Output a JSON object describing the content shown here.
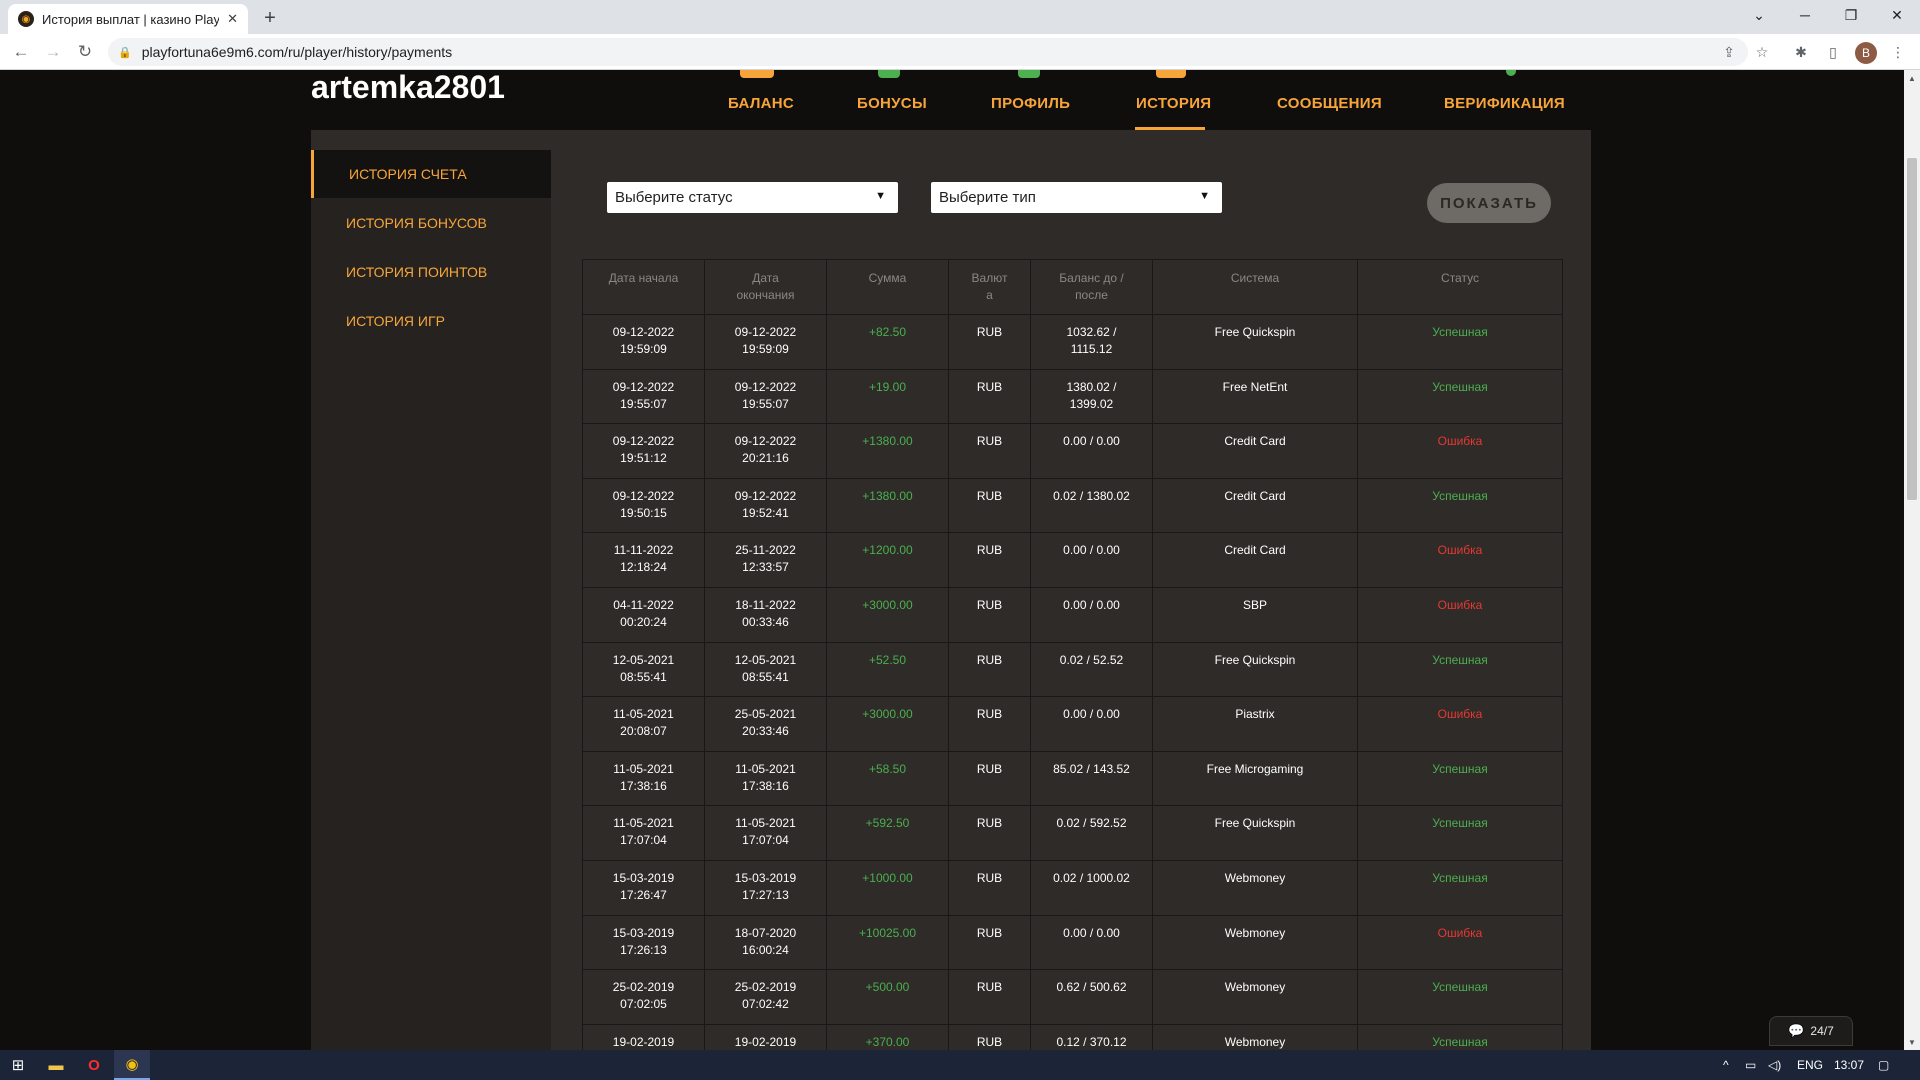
{
  "browser": {
    "tab_title": "История выплат | казино Playfo",
    "favicon_glyph": "◉",
    "close_glyph": "✕",
    "newtab_glyph": "+",
    "url": "playfortuna6e9m6.com/ru/player/history/payments",
    "profile_initial": "B",
    "controls": {
      "chevron": "⌄",
      "minimize": "─",
      "restore": "❐",
      "close": "✕"
    },
    "nav": {
      "back": "←",
      "forward": "→",
      "reload": "↻",
      "lock": "🔒"
    },
    "toolbar": {
      "share": "⇪",
      "bookmark": "☆",
      "extensions": "✱",
      "sidepanel": "▯"
    }
  },
  "header": {
    "username": "artemka2801",
    "nav": [
      {
        "label": "БАЛАНС"
      },
      {
        "label": "БОНУСЫ"
      },
      {
        "label": "ПРОФИЛЬ"
      },
      {
        "label": "ИСТОРИЯ",
        "active": true
      },
      {
        "label": "СООБЩЕНИЯ"
      },
      {
        "label": "ВЕРИФИКАЦИЯ"
      }
    ]
  },
  "sidebar": {
    "items": [
      {
        "label": "ИСТОРИЯ СЧЕТА",
        "active": true
      },
      {
        "label": "ИСТОРИЯ БОНУСОВ"
      },
      {
        "label": "ИСТОРИЯ ПОИНТОВ"
      },
      {
        "label": "ИСТОРИЯ ИГР"
      }
    ]
  },
  "filters": {
    "status_placeholder": "Выберите статус",
    "type_placeholder": "Выберите тип",
    "caret": "▼",
    "show_label": "ПОКАЗАТЬ"
  },
  "table": {
    "columns": {
      "start": [
        "Дата начала"
      ],
      "end": [
        "Дата",
        "окончания"
      ],
      "amount": [
        "Сумма"
      ],
      "currency": [
        "Валют",
        "а"
      ],
      "balance": [
        "Баланс до /",
        "после"
      ],
      "system": [
        "Система"
      ],
      "status": [
        "Статус"
      ]
    },
    "rows": [
      {
        "start": [
          "09-12-2022",
          "19:59:09"
        ],
        "end": [
          "09-12-2022",
          "19:59:09"
        ],
        "amount": "+82.50",
        "currency": "RUB",
        "balance": [
          "1032.62 /",
          "1115.12"
        ],
        "system": "Free Quickspin",
        "status": "Успешная",
        "ok": true
      },
      {
        "start": [
          "09-12-2022",
          "19:55:07"
        ],
        "end": [
          "09-12-2022",
          "19:55:07"
        ],
        "amount": "+19.00",
        "currency": "RUB",
        "balance": [
          "1380.02 /",
          "1399.02"
        ],
        "system": "Free NetEnt",
        "status": "Успешная",
        "ok": true
      },
      {
        "start": [
          "09-12-2022",
          "19:51:12"
        ],
        "end": [
          "09-12-2022",
          "20:21:16"
        ],
        "amount": "+1380.00",
        "currency": "RUB",
        "balance": [
          "0.00 / 0.00"
        ],
        "system": "Credit Card",
        "status": "Ошибка",
        "ok": false
      },
      {
        "start": [
          "09-12-2022",
          "19:50:15"
        ],
        "end": [
          "09-12-2022",
          "19:52:41"
        ],
        "amount": "+1380.00",
        "currency": "RUB",
        "balance": [
          "0.02 / 1380.02"
        ],
        "system": "Credit Card",
        "status": "Успешная",
        "ok": true
      },
      {
        "start": [
          "11-11-2022",
          "12:18:24"
        ],
        "end": [
          "25-11-2022",
          "12:33:57"
        ],
        "amount": "+1200.00",
        "currency": "RUB",
        "balance": [
          "0.00 / 0.00"
        ],
        "system": "Credit Card",
        "status": "Ошибка",
        "ok": false
      },
      {
        "start": [
          "04-11-2022",
          "00:20:24"
        ],
        "end": [
          "18-11-2022",
          "00:33:46"
        ],
        "amount": "+3000.00",
        "currency": "RUB",
        "balance": [
          "0.00 / 0.00"
        ],
        "system": "SBP",
        "status": "Ошибка",
        "ok": false
      },
      {
        "start": [
          "12-05-2021",
          "08:55:41"
        ],
        "end": [
          "12-05-2021",
          "08:55:41"
        ],
        "amount": "+52.50",
        "currency": "RUB",
        "balance": [
          "0.02 / 52.52"
        ],
        "system": "Free Quickspin",
        "status": "Успешная",
        "ok": true
      },
      {
        "start": [
          "11-05-2021",
          "20:08:07"
        ],
        "end": [
          "25-05-2021",
          "20:33:46"
        ],
        "amount": "+3000.00",
        "currency": "RUB",
        "balance": [
          "0.00 / 0.00"
        ],
        "system": "Piastrix",
        "status": "Ошибка",
        "ok": false
      },
      {
        "start": [
          "11-05-2021",
          "17:38:16"
        ],
        "end": [
          "11-05-2021",
          "17:38:16"
        ],
        "amount": "+58.50",
        "currency": "RUB",
        "balance": [
          "85.02 / 143.52"
        ],
        "system": "Free Microgaming",
        "status": "Успешная",
        "ok": true
      },
      {
        "start": [
          "11-05-2021",
          "17:07:04"
        ],
        "end": [
          "11-05-2021",
          "17:07:04"
        ],
        "amount": "+592.50",
        "currency": "RUB",
        "balance": [
          "0.02 / 592.52"
        ],
        "system": "Free Quickspin",
        "status": "Успешная",
        "ok": true
      },
      {
        "start": [
          "15-03-2019",
          "17:26:47"
        ],
        "end": [
          "15-03-2019",
          "17:27:13"
        ],
        "amount": "+1000.00",
        "currency": "RUB",
        "balance": [
          "0.02 / 1000.02"
        ],
        "system": "Webmoney",
        "status": "Успешная",
        "ok": true
      },
      {
        "start": [
          "15-03-2019",
          "17:26:13"
        ],
        "end": [
          "18-07-2020",
          "16:00:24"
        ],
        "amount": "+10025.00",
        "currency": "RUB",
        "balance": [
          "0.00 / 0.00"
        ],
        "system": "Webmoney",
        "status": "Ошибка",
        "ok": false
      },
      {
        "start": [
          "25-02-2019",
          "07:02:05"
        ],
        "end": [
          "25-02-2019",
          "07:02:42"
        ],
        "amount": "+500.00",
        "currency": "RUB",
        "balance": [
          "0.62 / 500.62"
        ],
        "system": "Webmoney",
        "status": "Успешная",
        "ok": true
      },
      {
        "start": [
          "19-02-2019",
          ""
        ],
        "end": [
          "19-02-2019",
          ""
        ],
        "amount": "+370.00",
        "currency": "RUB",
        "balance": [
          "0.12 / 370.12"
        ],
        "system": "Webmoney",
        "status": "Успешная",
        "ok": true
      }
    ]
  },
  "chat": {
    "icon": "💬",
    "label": "24/7"
  },
  "taskbar": {
    "start_glyph": "⊞",
    "apps": [
      {
        "name": "file-explorer",
        "glyph": "▬"
      },
      {
        "name": "opera",
        "glyph": "O"
      },
      {
        "name": "chrome",
        "glyph": "◉"
      }
    ],
    "tray": {
      "caret": "^",
      "network": "▭",
      "volume": "◁)",
      "language": "ENG",
      "time": "13:07",
      "notifications": "▢"
    }
  },
  "colors": {
    "accent": "#f7a53a",
    "success": "#4caf50",
    "error": "#e53935",
    "panel": "#2e2b28",
    "page_bg": "#100e0c"
  }
}
